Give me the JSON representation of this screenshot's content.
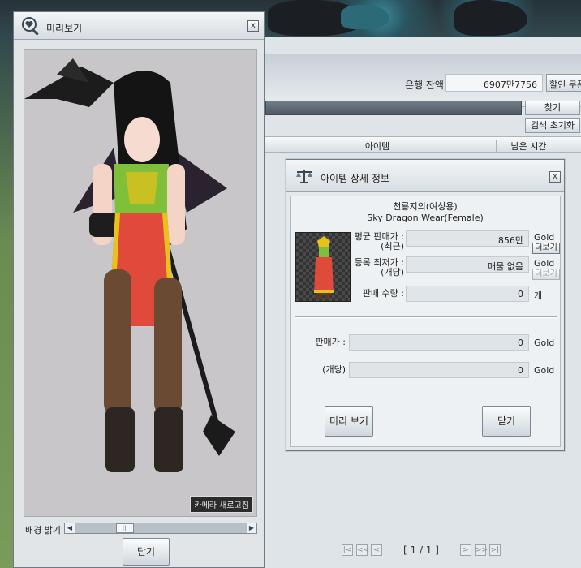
{
  "auction": {
    "bank_label": "은행 잔액",
    "bank_value": "6907만7756",
    "coupon_button": "할인 쿠폰",
    "search_button": "찾기",
    "reset_button": "검색 초기화",
    "col_item": "아이템",
    "col_time": "남은 시간",
    "page_indicator": "[ 1 / 1 ]",
    "pager_first": "|<",
    "pager_prev_many": "<<",
    "pager_prev": "<",
    "pager_next": ">",
    "pager_next_many": ">>",
    "pager_last": ">|"
  },
  "detail": {
    "title": "아이템 상세 정보",
    "close": "x",
    "name_ko": "천룡지의(여성용)",
    "name_en": "Sky Dragon Wear(Female)",
    "avg_price_label_1": "평균 판매가 :",
    "avg_price_label_2": "(최근)",
    "avg_price_value": "856만",
    "avg_price_unit": "Gold",
    "avg_more": "더보기",
    "min_price_label_1": "등록 최저가 :",
    "min_price_label_2": "(개당)",
    "min_price_value": "매물 없음",
    "min_price_unit": "Gold",
    "min_more": "더보기",
    "qty_label": "판매 수량 :",
    "qty_value": "0",
    "qty_unit": "개",
    "sell_price_label": "판매가 :",
    "sell_price_value": "0",
    "sell_price_unit": "Gold",
    "per_label": "(개당)",
    "per_value": "0",
    "per_unit": "Gold",
    "preview_button": "미리 보기",
    "close_button": "닫기"
  },
  "preview": {
    "title": "미리보기",
    "close": "x",
    "camera_reset": "카메라 새로고침",
    "brightness_label": "배경 밝기",
    "brightness_level": 0.27,
    "close_button": "닫기"
  },
  "colors": {
    "dress_green": "#7fbf3a",
    "dress_red": "#e04a3a",
    "gold_trim": "#e8c21a"
  }
}
